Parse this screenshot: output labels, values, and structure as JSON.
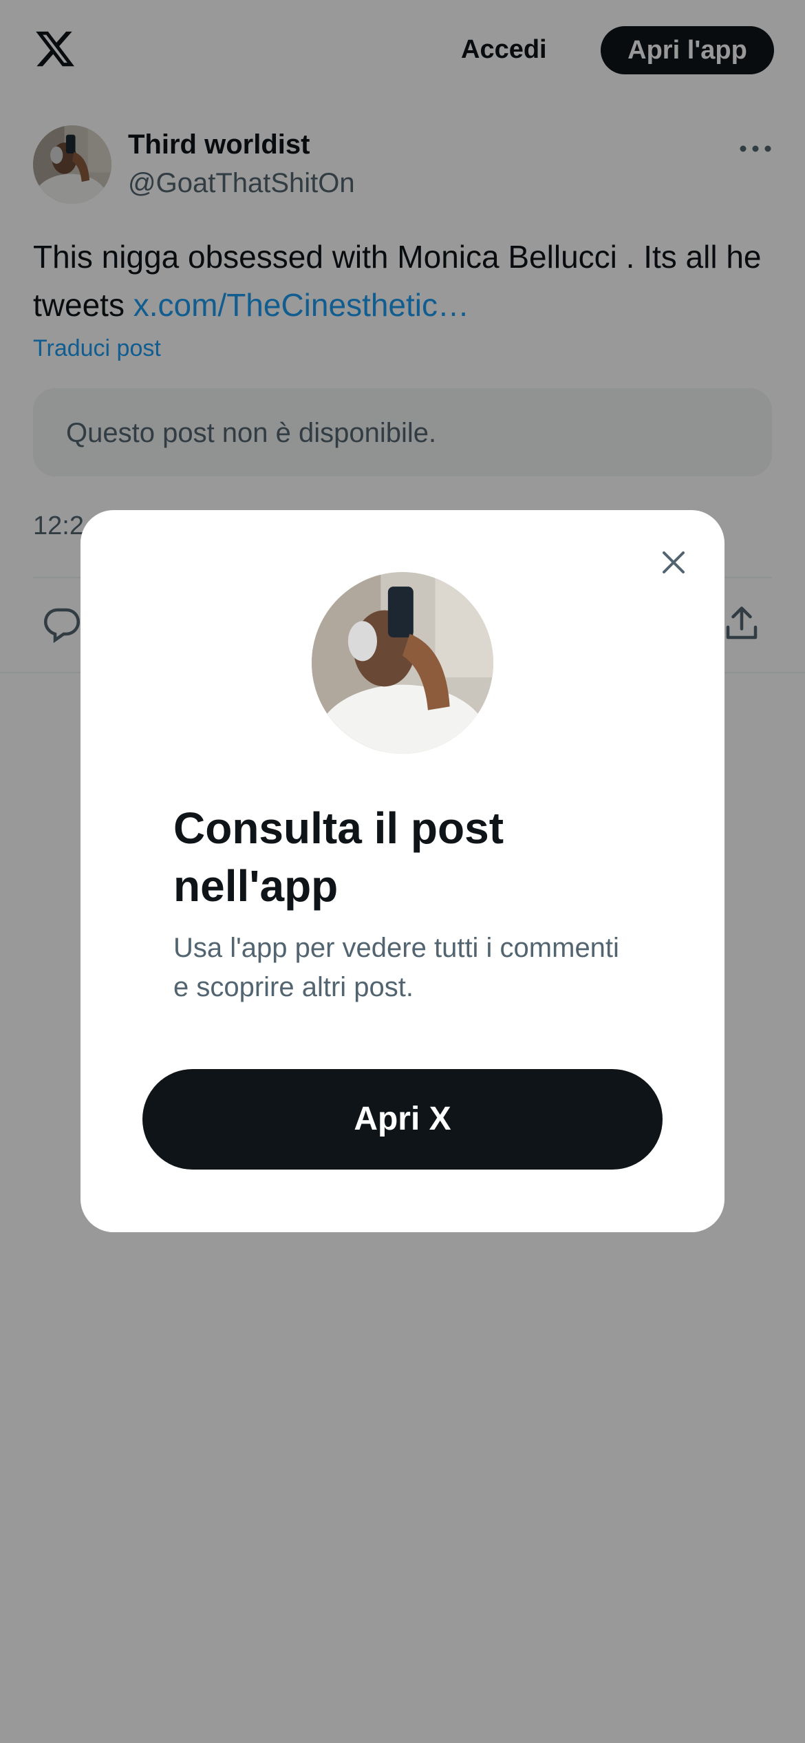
{
  "header": {
    "logo_icon": "x-logo-icon",
    "login_label": "Accedi",
    "open_app_label": "Apri l'app"
  },
  "post": {
    "author_name": "Third worldist",
    "author_handle": "@GoatThatShitOn",
    "text": "This nigga obsessed with Monica Bellucci . Its all he tweets ",
    "link_text": "x.com/TheCinesthetic…",
    "translate_label": "Traduci post",
    "quoted_unavailable": "Questo post non è disponibile.",
    "timestamp_visible": "12:2",
    "actions": {
      "reply_icon": "reply-icon",
      "share_icon": "share-icon",
      "more_icon": "more-icon"
    }
  },
  "modal": {
    "title": "Consulta il post nell'app",
    "subtitle": "Usa l'app per vedere tutti i commenti e scoprire altri post.",
    "button_label": "Apri X",
    "close_icon": "close-icon"
  },
  "colors": {
    "primary_dark": "#0f1419",
    "link_blue": "#1d9bf0",
    "secondary_text": "#536471",
    "overlay": "rgba(0,0,0,0.4)"
  }
}
